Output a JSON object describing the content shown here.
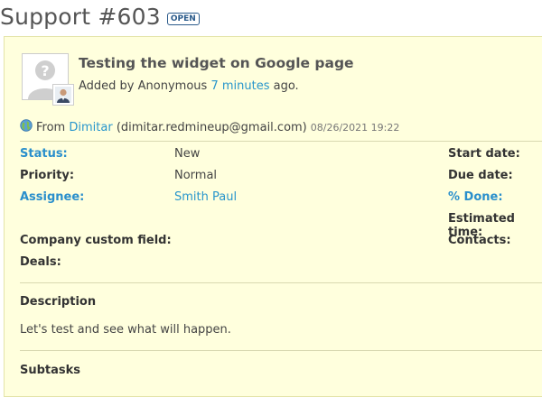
{
  "header": {
    "title": "Support #603",
    "status_tag": "OPEN"
  },
  "issue": {
    "subject": "Testing the widget on Google page",
    "added_by_prefix": "Added by",
    "author": "Anonymous",
    "time_ago": "7 minutes",
    "ago_suffix": "ago.",
    "from_label": "From",
    "from_name": "Dimitar",
    "from_email": "(dimitar.redmineup@gmail.com)",
    "from_date": "08/26/2021 19:22"
  },
  "attributes": {
    "status_label": "Status:",
    "status_value": "New",
    "priority_label": "Priority:",
    "priority_value": "Normal",
    "assignee_label": "Assignee:",
    "assignee_value": "Smith Paul",
    "start_date_label": "Start date:",
    "due_date_label": "Due date:",
    "done_label": "% Done:",
    "estimated_label": "Estimated time:",
    "company_field_label": "Company custom field:",
    "contacts_label": "Contacts:",
    "deals_label": "Deals:"
  },
  "description": {
    "title": "Description",
    "text": "Let's test and see what will happen."
  },
  "subtasks": {
    "title": "Subtasks"
  },
  "icons": {
    "avatar": "unknown-user-avatar",
    "mini_avatar": "user-photo-icon",
    "globe": "globe-icon"
  },
  "colors": {
    "issue_bg": "#ffffdd",
    "link": "#2996cc",
    "tag": "#2a5a8a"
  }
}
